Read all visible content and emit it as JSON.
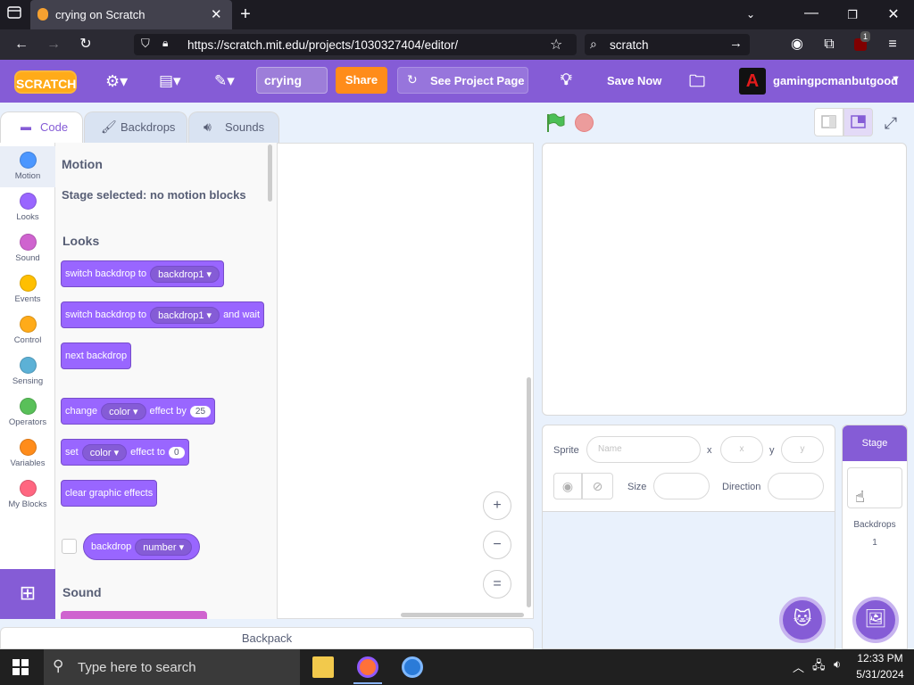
{
  "browser": {
    "tab_title": "crying on Scratch",
    "url": "https://scratch.mit.edu/projects/1030327404/editor/",
    "search_text": "scratch",
    "new_tab": "+",
    "extension_badge": "1"
  },
  "menubar": {
    "logo": "SCRATCH",
    "project_title": "crying",
    "share": "Share",
    "see_project_page": "See Project Page",
    "save_now": "Save Now",
    "username": "gamingpcmanbutgood",
    "avatar_letter": "A"
  },
  "editor_tabs": [
    {
      "label": "Code",
      "active": true
    },
    {
      "label": "Backdrops",
      "active": false
    },
    {
      "label": "Sounds",
      "active": false
    }
  ],
  "categories": [
    {
      "label": "Motion",
      "color": "#4c97ff"
    },
    {
      "label": "Looks",
      "color": "#9966ff"
    },
    {
      "label": "Sound",
      "color": "#cf63cf"
    },
    {
      "label": "Events",
      "color": "#ffbf00"
    },
    {
      "label": "Control",
      "color": "#ffab19"
    },
    {
      "label": "Sensing",
      "color": "#5cb1d6"
    },
    {
      "label": "Operators",
      "color": "#59c059"
    },
    {
      "label": "Variables",
      "color": "#ff8c1a"
    },
    {
      "label": "My Blocks",
      "color": "#ff6680"
    }
  ],
  "palette": {
    "motion_heading": "Motion",
    "motion_note": "Stage selected: no motion blocks",
    "looks_heading": "Looks",
    "sound_heading": "Sound",
    "blocks": {
      "switch_backdrop_to": "switch backdrop to",
      "backdrop1": "backdrop1",
      "and_wait": "and wait",
      "next_backdrop": "next backdrop",
      "change": "change",
      "color": "color",
      "effect_by": "effect by",
      "effect_by_value": "25",
      "set": "set",
      "effect_to": "effect to",
      "effect_to_value": "0",
      "clear_graphic_effects": "clear graphic effects",
      "backdrop": "backdrop",
      "number": "number"
    }
  },
  "zoom": {
    "zoom_in": "+",
    "zoom_out": "−",
    "reset": "="
  },
  "backpack": "Backpack",
  "sprite_info": {
    "sprite_label": "Sprite",
    "name_placeholder": "Name",
    "x_label": "x",
    "x_placeholder": "x",
    "y_label": "y",
    "y_placeholder": "y",
    "size_label": "Size",
    "direction_label": "Direction"
  },
  "stage_pane": {
    "title": "Stage",
    "backdrops_label": "Backdrops",
    "backdrops_count": "1"
  },
  "taskbar": {
    "search_placeholder": "Type here to search",
    "time": "12:33 PM",
    "date": "5/31/2024"
  }
}
